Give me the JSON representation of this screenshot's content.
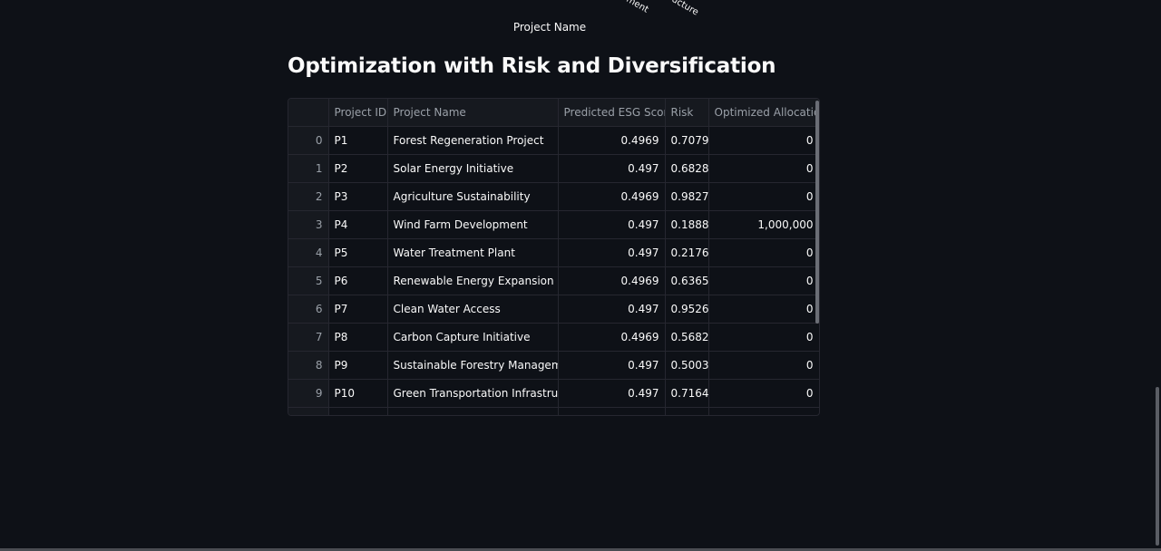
{
  "chart_fragment": {
    "tick_labels": [
      "ment",
      "ucture"
    ],
    "x_axis_title": "Project Name"
  },
  "section": {
    "title": "Optimization with Risk and Diversification"
  },
  "table": {
    "columns": [
      "",
      "Project ID",
      "Project Name",
      "Predicted ESG Score",
      "Risk",
      "Optimized Allocation"
    ],
    "rows": [
      {
        "index": "0",
        "id": "P1",
        "name": "Forest Regeneration Project",
        "esg": "0.4969",
        "risk": "0.7079",
        "alloc": "0"
      },
      {
        "index": "1",
        "id": "P2",
        "name": "Solar Energy Initiative",
        "esg": "0.497",
        "risk": "0.6828",
        "alloc": "0"
      },
      {
        "index": "2",
        "id": "P3",
        "name": "Agriculture Sustainability",
        "esg": "0.4969",
        "risk": "0.9827",
        "alloc": "0"
      },
      {
        "index": "3",
        "id": "P4",
        "name": "Wind Farm Development",
        "esg": "0.497",
        "risk": "0.1888",
        "alloc": "1,000,000"
      },
      {
        "index": "4",
        "id": "P5",
        "name": "Water Treatment Plant",
        "esg": "0.497",
        "risk": "0.2176",
        "alloc": "0"
      },
      {
        "index": "5",
        "id": "P6",
        "name": "Renewable Energy Expansion",
        "esg": "0.4969",
        "risk": "0.6365",
        "alloc": "0"
      },
      {
        "index": "6",
        "id": "P7",
        "name": "Clean Water Access",
        "esg": "0.497",
        "risk": "0.9526",
        "alloc": "0"
      },
      {
        "index": "7",
        "id": "P8",
        "name": "Carbon Capture Initiative",
        "esg": "0.4969",
        "risk": "0.5682",
        "alloc": "0"
      },
      {
        "index": "8",
        "id": "P9",
        "name": "Sustainable Forestry Management",
        "esg": "0.497",
        "risk": "0.5003",
        "alloc": "0"
      },
      {
        "index": "9",
        "id": "P10",
        "name": "Green Transportation Infrastructure",
        "esg": "0.497",
        "risk": "0.7164",
        "alloc": "0"
      }
    ]
  }
}
